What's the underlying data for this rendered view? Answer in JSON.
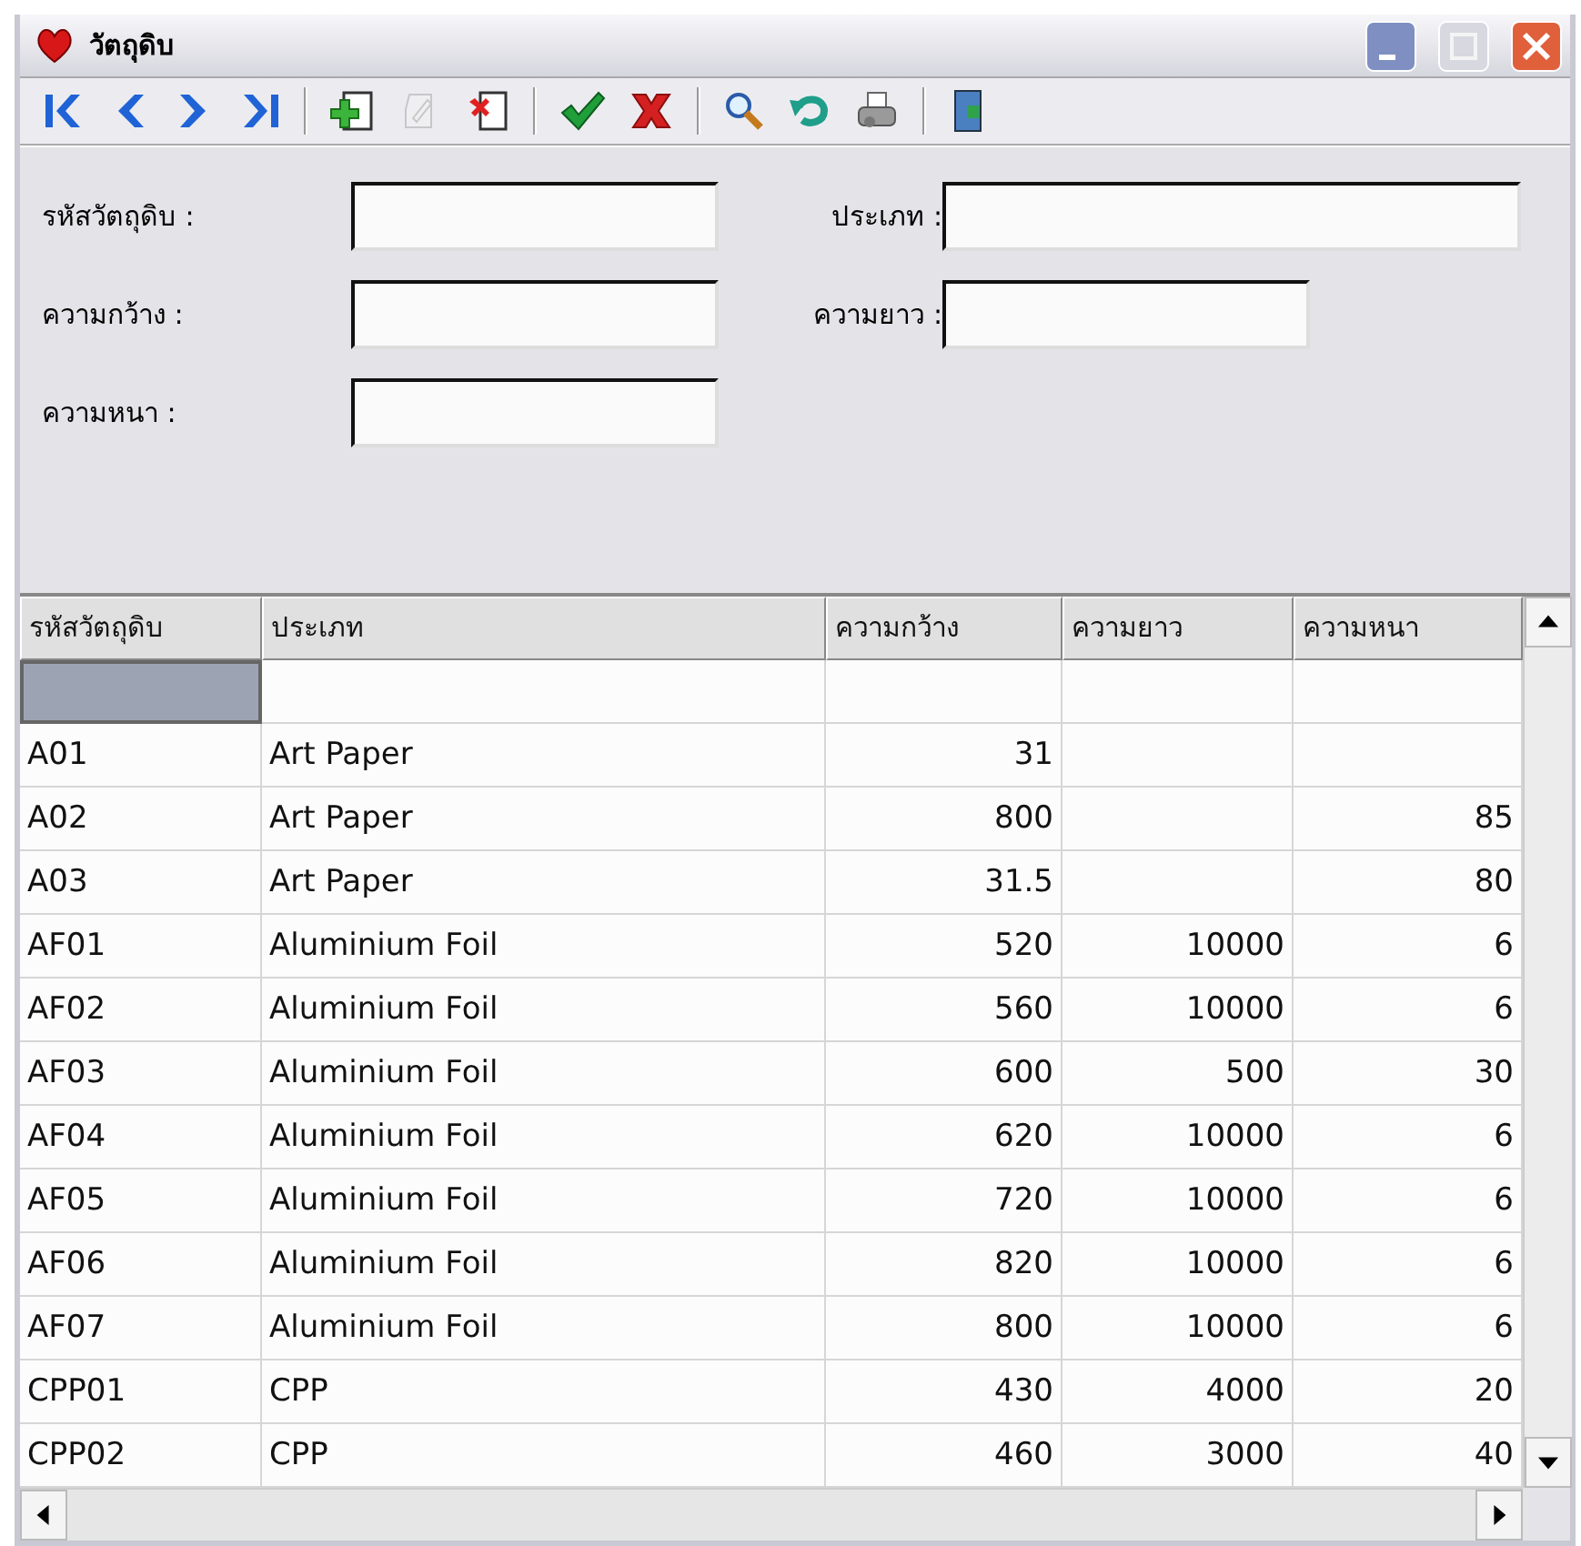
{
  "window": {
    "title": "วัตถุดิบ",
    "controls": [
      {
        "kind": "minimize",
        "disabled": false
      },
      {
        "kind": "maximize",
        "disabled": true
      },
      {
        "kind": "close",
        "disabled": false
      }
    ]
  },
  "toolbar": [
    [
      {
        "kind": "first",
        "disabled": false
      },
      {
        "kind": "prev",
        "disabled": false
      },
      {
        "kind": "next",
        "disabled": false
      },
      {
        "kind": "last",
        "disabled": false
      }
    ],
    [
      {
        "kind": "add",
        "disabled": false
      },
      {
        "kind": "edit",
        "disabled": true
      },
      {
        "kind": "delete",
        "disabled": false
      }
    ],
    [
      {
        "kind": "save",
        "disabled": false
      },
      {
        "kind": "cancel",
        "disabled": false
      }
    ],
    [
      {
        "kind": "search",
        "disabled": false
      },
      {
        "kind": "undo",
        "disabled": false
      },
      {
        "kind": "print",
        "disabled": false
      }
    ],
    [
      {
        "kind": "exit",
        "disabled": false
      }
    ]
  ],
  "form": {
    "rows": [
      [
        {
          "label": "รหัสวัตถุดิบ :"
        },
        {
          "label": "ประเภท :"
        }
      ],
      [
        {
          "label": "ความกว้าง :"
        },
        {
          "label": "ความยาว :"
        }
      ],
      [
        {
          "label": "ความหนา :"
        }
      ]
    ]
  },
  "table": {
    "columns": [
      "รหัสวัตถุดิบ",
      "ประเภท",
      "ความกว้าง",
      "ความยาว",
      "ความหนา"
    ],
    "rows": [
      {
        "kind": "new",
        "selected": true
      },
      {
        "kind": "data",
        "selected": false,
        "cells": [
          "A01",
          "Art Paper",
          "31",
          null,
          null
        ]
      },
      {
        "kind": "data",
        "selected": false,
        "cells": [
          "A02",
          "Art Paper",
          "800",
          null,
          "85"
        ]
      },
      {
        "kind": "data",
        "selected": false,
        "cells": [
          "A03",
          "Art Paper",
          "31.5",
          null,
          "80"
        ]
      },
      {
        "kind": "data",
        "selected": false,
        "cells": [
          "AF01",
          "Aluminium Foil",
          "520",
          "10000",
          "6"
        ]
      },
      {
        "kind": "data",
        "selected": false,
        "cells": [
          "AF02",
          "Aluminium Foil",
          "560",
          "10000",
          "6"
        ]
      },
      {
        "kind": "data",
        "selected": false,
        "cells": [
          "AF03",
          "Aluminium Foil",
          "600",
          "500",
          "30"
        ]
      },
      {
        "kind": "data",
        "selected": false,
        "cells": [
          "AF04",
          "Aluminium Foil",
          "620",
          "10000",
          "6"
        ]
      },
      {
        "kind": "data",
        "selected": false,
        "cells": [
          "AF05",
          "Aluminium Foil",
          "720",
          "10000",
          "6"
        ]
      },
      {
        "kind": "data",
        "selected": false,
        "cells": [
          "AF06",
          "Aluminium Foil",
          "820",
          "10000",
          "6"
        ]
      },
      {
        "kind": "data",
        "selected": false,
        "cells": [
          "AF07",
          "Aluminium Foil",
          "800",
          "10000",
          "6"
        ]
      },
      {
        "kind": "data",
        "selected": false,
        "cells": [
          "CPP01",
          "CPP",
          "430",
          "4000",
          "20"
        ]
      },
      {
        "kind": "data",
        "selected": false,
        "cells": [
          "CPP02",
          "CPP",
          "460",
          "3000",
          "40"
        ]
      }
    ]
  }
}
